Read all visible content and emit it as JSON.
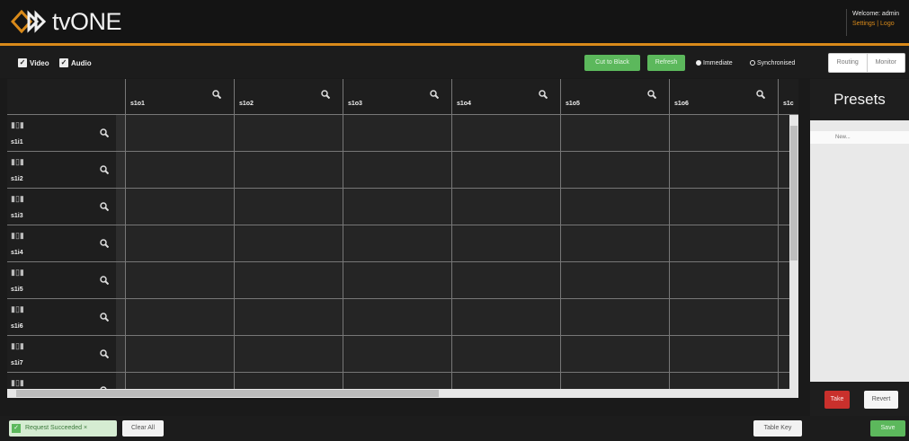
{
  "header": {
    "logo_text": "tvONE",
    "welcome": "Welcome: admin",
    "settings_link": "Settings",
    "separator": "|",
    "logout_link": "Logo"
  },
  "toolbar": {
    "video_label": "Video",
    "audio_label": "Audio",
    "cut_to_black": "Cut to Black",
    "refresh": "Refresh",
    "immediate": "Immediate",
    "synchronised": "Synchronised",
    "routing": "Routing",
    "monitor": "Monitor"
  },
  "grid": {
    "columns": [
      "s1o1",
      "s1o2",
      "s1o3",
      "s1o4",
      "s1o5",
      "s1o6",
      "s1c"
    ],
    "rows": [
      "s1i1",
      "s1i2",
      "s1i3",
      "s1i4",
      "s1i5",
      "s1i6",
      "s1i7",
      ""
    ]
  },
  "presets": {
    "title": "Presets",
    "new_item": "New...",
    "take": "Take",
    "revert": "Revert"
  },
  "footer": {
    "status": "Request Succeeded",
    "status_close": "×",
    "clear_all": "Clear All",
    "table_key": "Table Key",
    "save": "Save"
  },
  "colors": {
    "accent": "#d98a1a",
    "green": "#5cb85c",
    "red": "#c9302c"
  }
}
